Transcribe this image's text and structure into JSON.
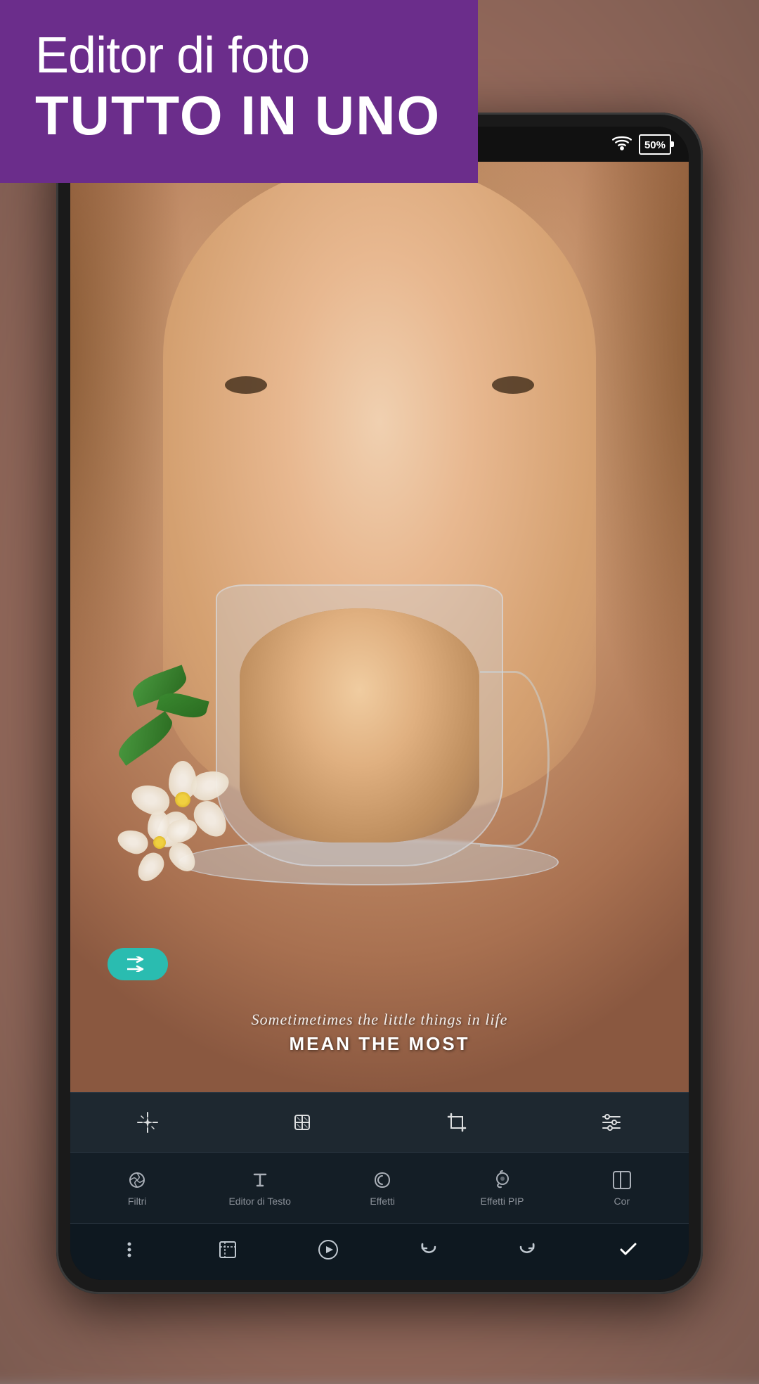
{
  "app": {
    "banner": {
      "line1": "Editor di foto",
      "line2": "TUTTO IN UNO"
    },
    "statusBar": {
      "battery": "50%"
    },
    "photo": {
      "quoteScript": "Sometimetimes the little things in life",
      "quoteBold": "MEAN THE MOST"
    },
    "shuffleBtn": {
      "label": "shuffle"
    },
    "toolsRow": [
      {
        "icon": "✦",
        "name": "sparkle-tool"
      },
      {
        "icon": "⊞",
        "name": "patch-tool"
      },
      {
        "icon": "⛶",
        "name": "crop-tool"
      },
      {
        "icon": "⧉",
        "name": "adjust-tool"
      }
    ],
    "bottomTabs": [
      {
        "label": "Filtri",
        "icon": "✿",
        "name": "filters-tab"
      },
      {
        "label": "Editor di Testo",
        "icon": "T",
        "name": "text-editor-tab"
      },
      {
        "label": "Effetti",
        "icon": "♡",
        "name": "effects-tab"
      },
      {
        "label": "Effetti PIP",
        "icon": "❧",
        "name": "pip-effects-tab"
      },
      {
        "label": "Cor",
        "icon": "⌐",
        "name": "cor-tab"
      }
    ],
    "actionBar": [
      {
        "icon": "⋮",
        "name": "more-button"
      },
      {
        "icon": "⊡",
        "name": "crop-button"
      },
      {
        "icon": "▶",
        "name": "play-button"
      },
      {
        "icon": "↩",
        "name": "undo-button"
      },
      {
        "icon": "↪",
        "name": "redo-button"
      },
      {
        "icon": "✓",
        "name": "confirm-button"
      }
    ]
  }
}
